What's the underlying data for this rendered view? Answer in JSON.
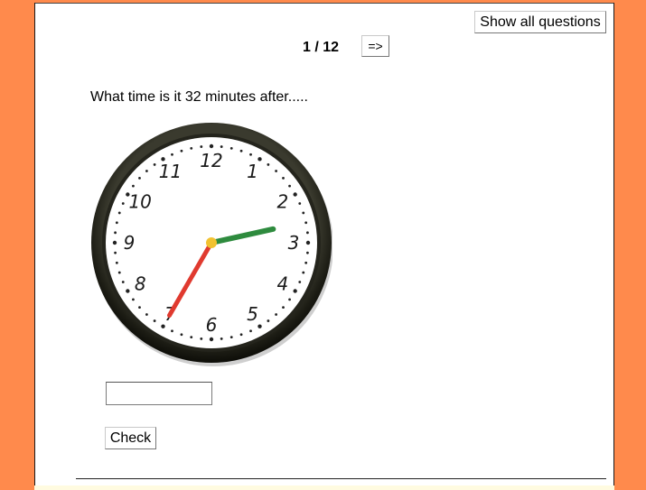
{
  "toolbar": {
    "show_all_label": "Show all questions",
    "counter": "1 / 12",
    "next_label": "=>"
  },
  "question": {
    "text": "What time is it 32 minutes after.....",
    "answer_value": "",
    "check_label": "Check"
  },
  "clock": {
    "numerals": [
      "12",
      "1",
      "2",
      "3",
      "4",
      "5",
      "6",
      "7",
      "8",
      "9",
      "10",
      "11"
    ],
    "hour": 2,
    "minute": 35,
    "hour_hand_color": "#2e8b3e",
    "minute_hand_color": "#e03a2f",
    "center_color": "#f2c230"
  },
  "colors": {
    "background": "#ff8a4c",
    "page": "#ffffff"
  }
}
